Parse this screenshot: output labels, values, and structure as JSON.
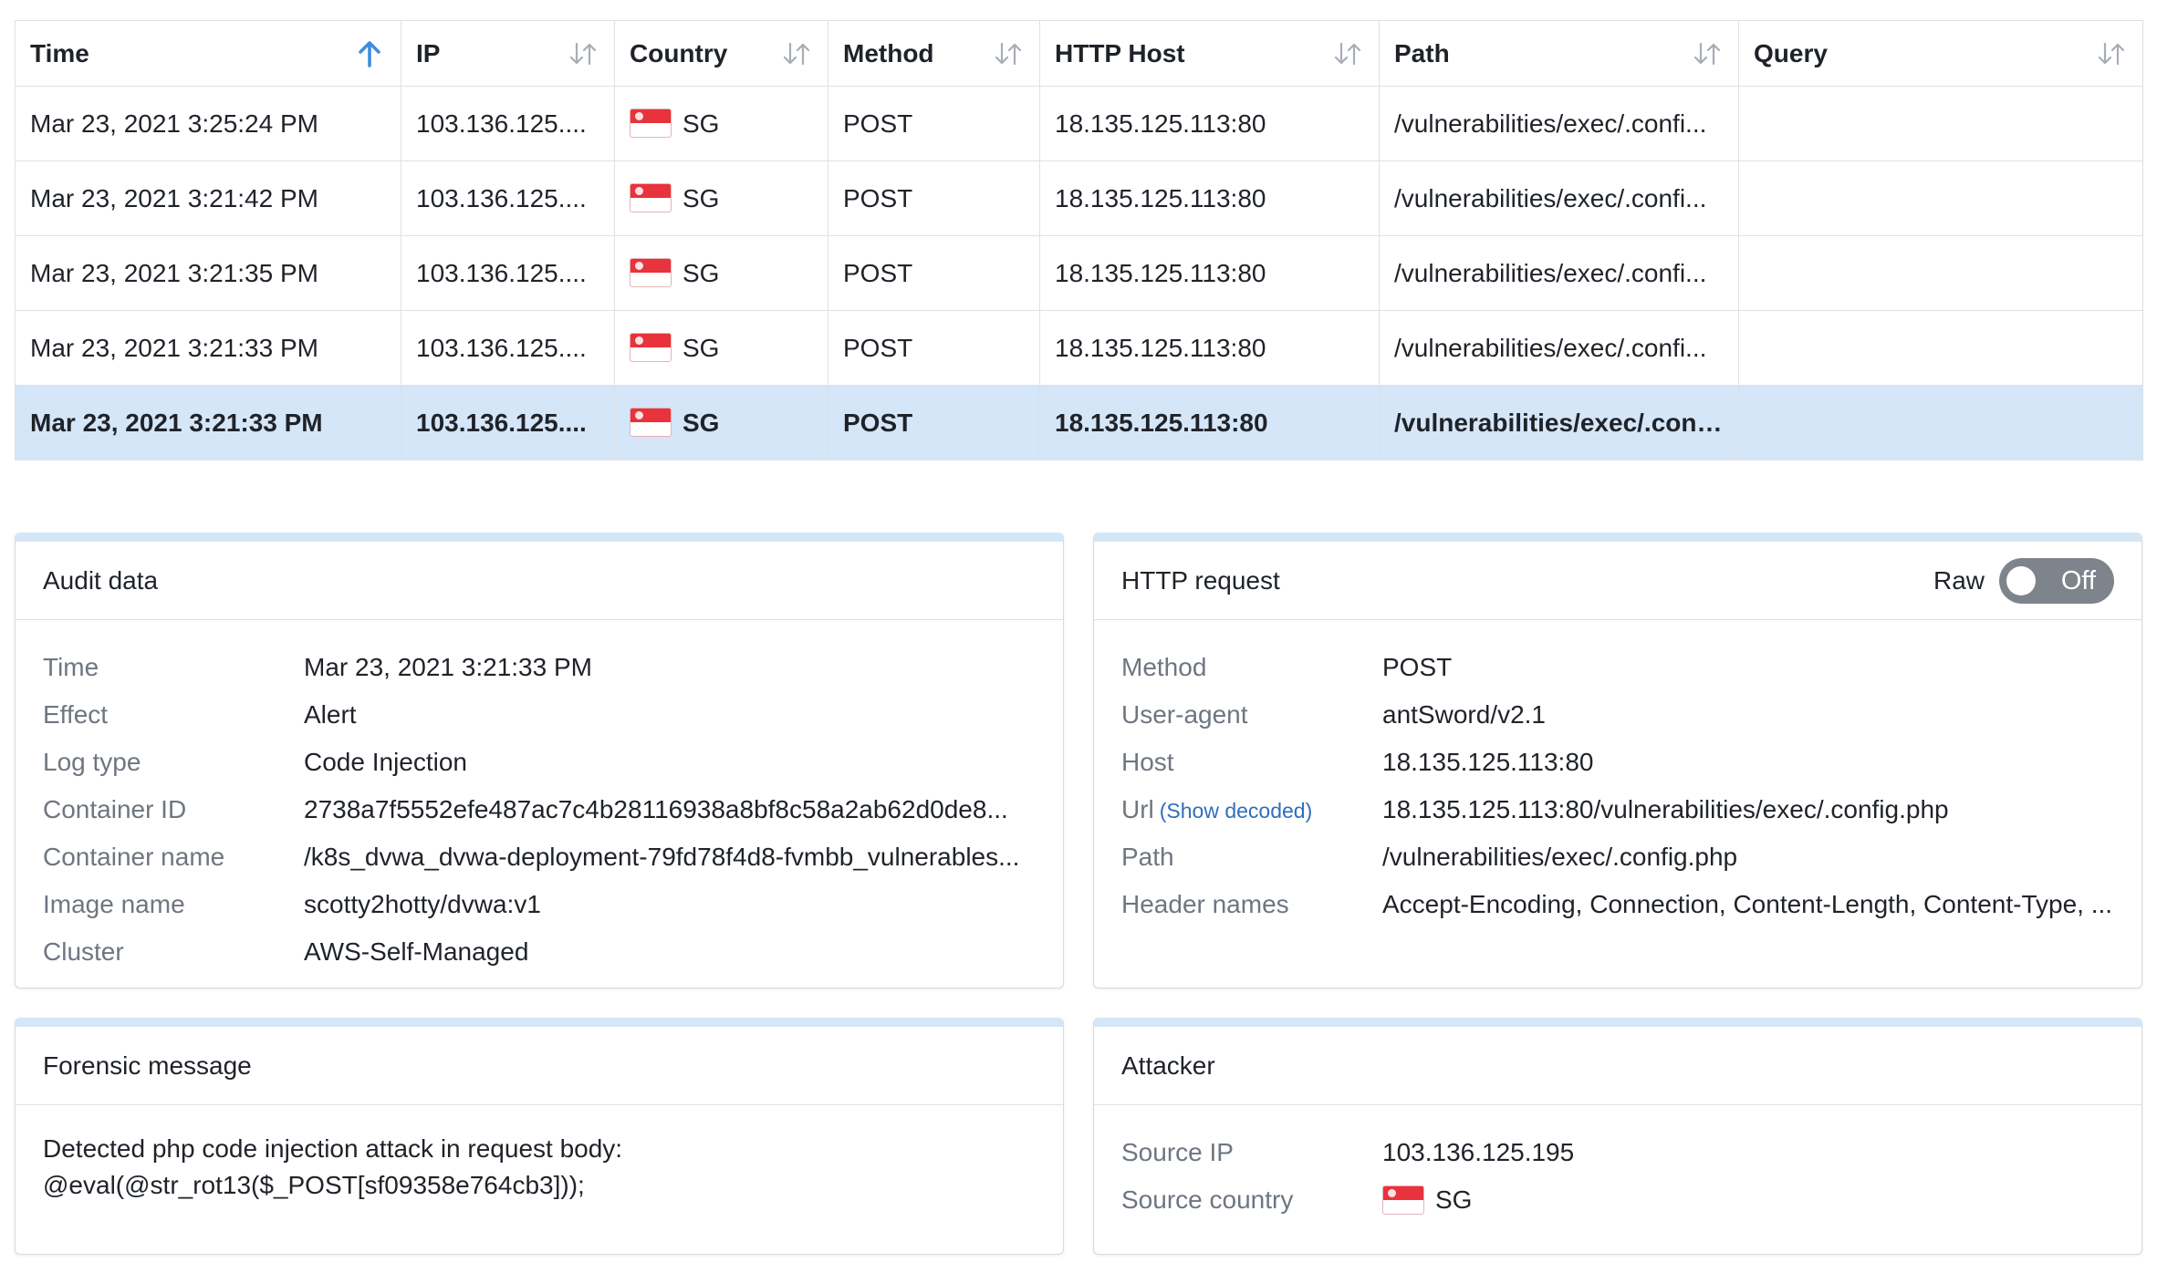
{
  "table": {
    "columns": [
      {
        "key": "time",
        "label": "Time",
        "sort": "asc"
      },
      {
        "key": "ip",
        "label": "IP",
        "sort": "none"
      },
      {
        "key": "country",
        "label": "Country",
        "sort": "none"
      },
      {
        "key": "method",
        "label": "Method",
        "sort": "none"
      },
      {
        "key": "host",
        "label": "HTTP Host",
        "sort": "none"
      },
      {
        "key": "path",
        "label": "Path",
        "sort": "none"
      },
      {
        "key": "query",
        "label": "Query",
        "sort": "none"
      }
    ],
    "rows": [
      {
        "time": "Mar 23, 2021 3:25:24 PM",
        "ip": "103.136.125....",
        "country": "SG",
        "method": "POST",
        "host": "18.135.125.113:80",
        "path": "/vulnerabilities/exec/.confi...",
        "query": ""
      },
      {
        "time": "Mar 23, 2021 3:21:42 PM",
        "ip": "103.136.125....",
        "country": "SG",
        "method": "POST",
        "host": "18.135.125.113:80",
        "path": "/vulnerabilities/exec/.confi...",
        "query": ""
      },
      {
        "time": "Mar 23, 2021 3:21:35 PM",
        "ip": "103.136.125....",
        "country": "SG",
        "method": "POST",
        "host": "18.135.125.113:80",
        "path": "/vulnerabilities/exec/.confi...",
        "query": ""
      },
      {
        "time": "Mar 23, 2021 3:21:33 PM",
        "ip": "103.136.125....",
        "country": "SG",
        "method": "POST",
        "host": "18.135.125.113:80",
        "path": "/vulnerabilities/exec/.confi...",
        "query": ""
      },
      {
        "time": "Mar 23, 2021 3:21:33 PM",
        "ip": "103.136.125....",
        "country": "SG",
        "method": "POST",
        "host": "18.135.125.113:80",
        "path": "/vulnerabilities/exec/.confi...",
        "query": "",
        "selected": true
      }
    ]
  },
  "audit": {
    "title": "Audit data",
    "fields": [
      {
        "label": "Time",
        "value": "Mar 23, 2021 3:21:33 PM"
      },
      {
        "label": "Effect",
        "value": "Alert"
      },
      {
        "label": "Log type",
        "value": "Code Injection"
      },
      {
        "label": "Container ID",
        "value": "2738a7f5552efe487ac7c4b28116938a8bf8c58a2ab62d0de8..."
      },
      {
        "label": "Container name",
        "value": "/k8s_dvwa_dvwa-deployment-79fd78f4d8-fvmbb_vulnerables..."
      },
      {
        "label": "Image name",
        "value": "scotty2hotty/dvwa:v1"
      },
      {
        "label": "Cluster",
        "value": "AWS-Self-Managed"
      }
    ]
  },
  "http": {
    "title": "HTTP request",
    "raw_label": "Raw",
    "toggle_state": "Off",
    "show_decoded": "(Show decoded)",
    "fields": [
      {
        "label": "Method",
        "value": "POST"
      },
      {
        "label": "User-agent",
        "value": "antSword/v2.1"
      },
      {
        "label": "Host",
        "value": "18.135.125.113:80"
      },
      {
        "label": "Url",
        "value": "18.135.125.113:80/vulnerabilities/exec/.config.php"
      },
      {
        "label": "Path",
        "value": "/vulnerabilities/exec/.config.php"
      },
      {
        "label": "Header names",
        "value": "Accept-Encoding, Connection, Content-Length, Content-Type, ..."
      }
    ]
  },
  "forensic": {
    "title": "Forensic message",
    "line1": "Detected php code injection attack in request body:",
    "line2": "@eval(@str_rot13($_POST[sf09358e764cb3]));"
  },
  "attacker": {
    "title": "Attacker",
    "source_ip_label": "Source IP",
    "source_ip": "103.136.125.195",
    "source_country_label": "Source country",
    "source_country": "SG"
  },
  "colors": {
    "selected_row": "#d4e6f8",
    "panel_accent": "#d5e7f7",
    "sort_active": "#3d8ee0",
    "link": "#2f6fbe"
  }
}
